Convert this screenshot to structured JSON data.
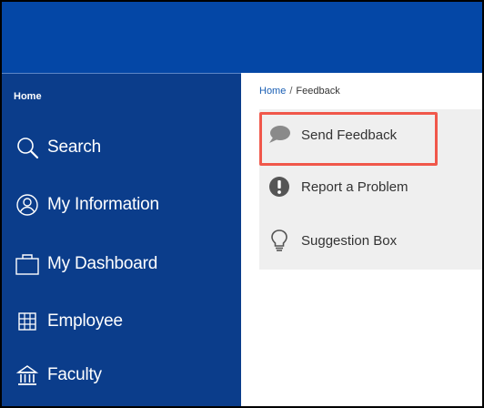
{
  "sidebar": {
    "home_label": "Home",
    "items": [
      {
        "label": "Search",
        "icon": "search-icon"
      },
      {
        "label": "My Information",
        "icon": "user-circle-icon"
      },
      {
        "label": "My Dashboard",
        "icon": "folder-icon"
      },
      {
        "label": "Employee",
        "icon": "building-icon"
      },
      {
        "label": "Faculty",
        "icon": "institution-icon"
      }
    ]
  },
  "breadcrumb": {
    "home": "Home",
    "separator": "/",
    "current": "Feedback"
  },
  "feedback_menu": {
    "items": [
      {
        "label": "Send Feedback",
        "icon": "speech-bubble-icon",
        "highlighted": true
      },
      {
        "label": "Report a Problem",
        "icon": "exclamation-icon",
        "highlighted": false
      },
      {
        "label": "Suggestion Box",
        "icon": "lightbulb-icon",
        "highlighted": false
      }
    ]
  },
  "colors": {
    "topbar": "#0447a6",
    "sidebar": "#0b3d8b",
    "highlight_border": "#f0574a",
    "menu_bg": "#efefef",
    "link": "#1a5fb4"
  }
}
